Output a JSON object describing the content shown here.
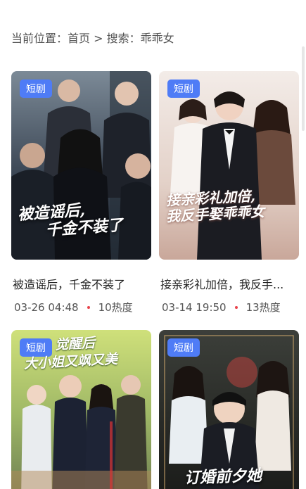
{
  "breadcrumb": {
    "prefix": "当前位置：",
    "home": "首页",
    "separator": " > ",
    "search_label": "搜索：",
    "query": "乖乖女"
  },
  "colors": {
    "badge": "#4f7cf6",
    "dot": "#e8434b"
  },
  "cards": [
    {
      "badge": "短剧",
      "poster_text": [
        "被造谣后,",
        "千金不装了"
      ],
      "title": "被造谣后，千金不装了",
      "date": "03-26 04:48",
      "heat": "10热度"
    },
    {
      "badge": "短剧",
      "poster_text": [
        "接亲彩礼加倍,",
        "我反手娶乖乖女"
      ],
      "title": "接亲彩礼加倍，我反手...",
      "date": "03-14 19:50",
      "heat": "13热度"
    },
    {
      "badge": "短剧",
      "poster_text": [
        "觉醒后",
        "大小姐又飒又美"
      ]
    },
    {
      "badge": "短剧",
      "poster_text": [
        "订婚前夕她"
      ]
    }
  ]
}
